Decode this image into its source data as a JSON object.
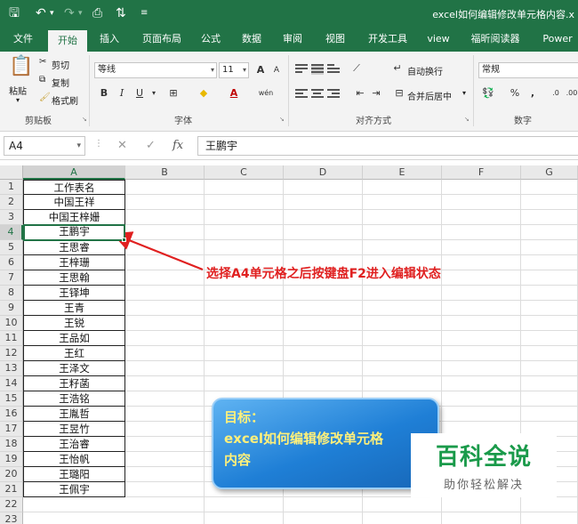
{
  "window": {
    "title": "excel如何编辑修改单元格内容.x"
  },
  "ribbon_tabs": [
    "文件",
    "开始",
    "插入",
    "页面布局",
    "公式",
    "数据",
    "审阅",
    "视图",
    "开发工具",
    "view",
    "福昕阅读器",
    "Power P"
  ],
  "ribbon": {
    "clipboard": {
      "paste": "粘贴",
      "cut": "剪切",
      "copy": "复制",
      "format_painter": "格式刷",
      "label": "剪贴板"
    },
    "font": {
      "name": "等线",
      "size": "11",
      "label": "字体",
      "bold": "B",
      "italic": "I",
      "underline": "U",
      "grow": "A",
      "shrink": "A",
      "wen": "wén"
    },
    "alignment": {
      "wrap": "自动换行",
      "merge": "合并后居中",
      "label": "对齐方式"
    },
    "number": {
      "format": "常规",
      "label": "数字",
      "percent": "%",
      "comma": ","
    }
  },
  "formula_bar": {
    "name_box": "A4",
    "fx": "fx",
    "content": "王鹏宇"
  },
  "columns": [
    "A",
    "B",
    "C",
    "D",
    "E",
    "F",
    "G"
  ],
  "rows": [
    "1",
    "2",
    "3",
    "4",
    "5",
    "6",
    "7",
    "8",
    "9",
    "10",
    "11",
    "12",
    "13",
    "14",
    "15",
    "16",
    "17",
    "18",
    "19",
    "20",
    "21",
    "22",
    "23"
  ],
  "cells": [
    "工作表名",
    "中国王祥",
    "中国王梓姗",
    "王鹏宇",
    "王思睿",
    "王梓珊",
    "王思翰",
    "王铎坤",
    "王青",
    "王锐",
    "王品如",
    "王红",
    "王泽文",
    "王籽菡",
    "王浩铭",
    "王胤哲",
    "王昱竹",
    "王治睿",
    "王怡帆",
    "王璐阳",
    "王佩宇"
  ],
  "annotation": "选择A4单元格之后按键盘F2进入编辑状态",
  "goal_box": {
    "line1": "目标：",
    "line2": "excel如何编辑修改单元格",
    "line3": "内容"
  },
  "watermark": {
    "big": "百科全说",
    "small": "助你轻松解决"
  },
  "colors": {
    "accent": "#217346",
    "annotation": "#e02020",
    "watermark": "#1a9a4a"
  }
}
